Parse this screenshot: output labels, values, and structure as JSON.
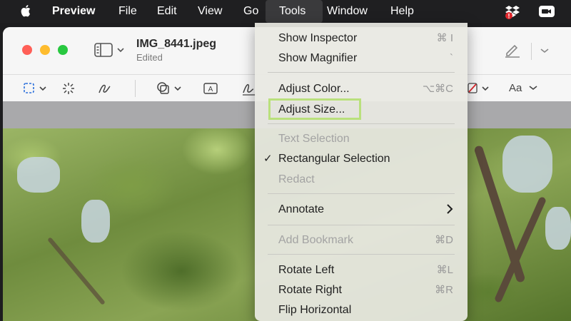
{
  "menubar": {
    "app_name": "Preview",
    "items": [
      "File",
      "Edit",
      "View",
      "Go",
      "Tools",
      "Window",
      "Help"
    ],
    "active_item": "Tools"
  },
  "window": {
    "title": "IMG_8441.jpeg",
    "subtitle": "Edited"
  },
  "toolbar": {
    "text_style_label": "Aa"
  },
  "tools_menu": {
    "items": [
      {
        "label": "Show Inspector",
        "shortcut": "⌘ I"
      },
      {
        "label": "Show Magnifier",
        "shortcut": "`"
      },
      {
        "label": "Adjust Color...",
        "shortcut": "⌥⌘C"
      },
      {
        "label": "Adjust Size..."
      },
      {
        "label": "Text Selection",
        "disabled": true
      },
      {
        "label": "Rectangular Selection",
        "checked": true
      },
      {
        "label": "Redact",
        "disabled": true
      },
      {
        "label": "Annotate",
        "submenu": true
      },
      {
        "label": "Add Bookmark",
        "shortcut": "⌘D",
        "disabled": true
      },
      {
        "label": "Rotate Left",
        "shortcut": "⌘L"
      },
      {
        "label": "Rotate Right",
        "shortcut": "⌘R"
      },
      {
        "label": "Flip Horizontal"
      }
    ]
  },
  "colors": {
    "highlight_border": "#b9e07c",
    "close": "#ff5f57",
    "minimize": "#febc2e",
    "zoom": "#28c840"
  }
}
